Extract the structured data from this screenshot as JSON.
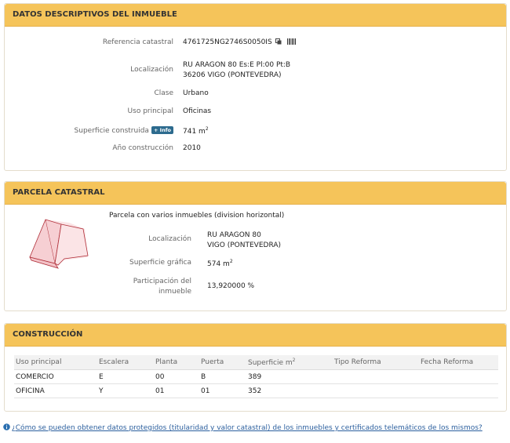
{
  "inmueble": {
    "title": "DATOS DESCRIPTIVOS DEL INMUEBLE",
    "fields": [
      {
        "label": "Referencia catastral",
        "value": "4761725NG2746S0050IS"
      },
      {
        "label": "Localización",
        "value_line1": "RU ARAGON 80 Es:E Pl:00 Pt:B",
        "value_line2": "36206 VIGO (PONTEVEDRA)"
      },
      {
        "label": "Clase",
        "value": "Urbano"
      },
      {
        "label": "Uso principal",
        "value": "Oficinas"
      },
      {
        "label": "Superficie construida",
        "badge": "+ Info",
        "value": "741 m",
        "unit_sup": "2"
      },
      {
        "label": "Año construcción",
        "value": "2010"
      }
    ]
  },
  "parcela": {
    "title": "PARCELA CATASTRAL",
    "description": "Parcela con varios inmuebles (division horizontal)",
    "localizacion_label": "Localización",
    "localizacion_line1": "RU ARAGON 80",
    "localizacion_line2": "VIGO (PONTEVEDRA)",
    "superficie_label": "Superficie gráfica",
    "superficie_value": "574 m",
    "superficie_sup": "2",
    "participacion_label_line1": "Participación del",
    "participacion_label_line2": "inmueble",
    "participacion_value": "13,920000 %"
  },
  "construccion": {
    "title": "CONSTRUCCIÓN",
    "columns": [
      "Uso principal",
      "Escalera",
      "Planta",
      "Puerta",
      "Superficie m",
      "Tipo Reforma",
      "Fecha Reforma"
    ],
    "superficie_sup": "2",
    "rows": [
      [
        "COMERCIO",
        "E",
        "00",
        "B",
        "389",
        "",
        ""
      ],
      [
        "OFICINA",
        "Y",
        "01",
        "01",
        "352",
        "",
        ""
      ]
    ]
  },
  "footer": {
    "link_text": "¿Cómo se pueden obtener datos protegidos (titularidad y valor catastral) de los inmuebles y certificados telemáticos de los mismos?"
  },
  "colors": {
    "header_bg": "#f5c45a",
    "parcel_fill": "#f6cfd3",
    "parcel_stroke": "#b0303a",
    "link": "#2b5f9e",
    "badge": "#2d6b8e"
  },
  "icons": [
    "copy-icon",
    "barcode-icon",
    "info-badge",
    "question-circle-icon",
    "parcel-map"
  ]
}
